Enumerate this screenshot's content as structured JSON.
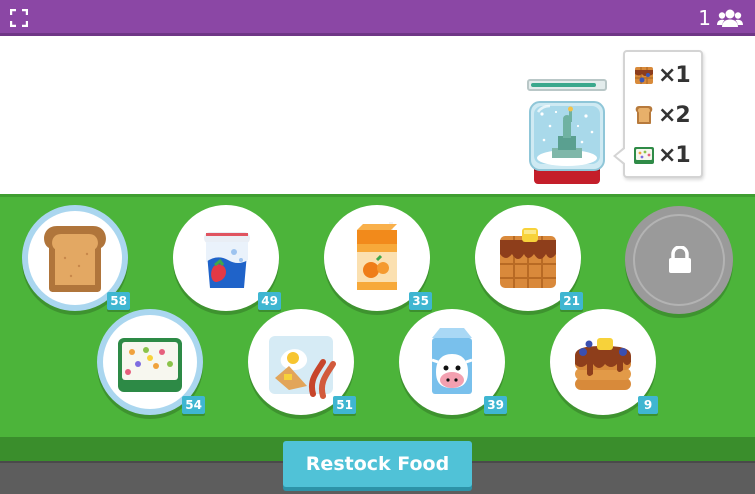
{
  "header": {
    "player_count": "1",
    "player_icon": "group-icon",
    "fullscreen_icon": "fullscreen-icon"
  },
  "customer": {
    "icon": "snow-globe-statue-of-liberty-icon",
    "patience_fraction": 0.9,
    "order": [
      {
        "item": "waffle-icon",
        "qty": "×1"
      },
      {
        "item": "toast-icon",
        "qty": "×2"
      },
      {
        "item": "cereal-icon",
        "qty": "×1"
      }
    ]
  },
  "foods": [
    {
      "name": "toast",
      "icon": "toast-icon",
      "count": "58"
    },
    {
      "name": "yogurt",
      "icon": "yogurt-icon",
      "count": "49"
    },
    {
      "name": "orange-juice",
      "icon": "orange-juice-icon",
      "count": "35"
    },
    {
      "name": "waffle",
      "icon": "waffle-icon",
      "count": "21"
    },
    {
      "name": "cereal",
      "icon": "cereal-icon",
      "count": "54"
    },
    {
      "name": "eggs-and-bacon",
      "icon": "eggs-bacon-icon",
      "count": "51"
    },
    {
      "name": "milk",
      "icon": "milk-icon",
      "count": "39"
    },
    {
      "name": "pancakes",
      "icon": "pancakes-icon",
      "count": "9"
    }
  ],
  "locked_slot": {
    "icon": "lock-icon"
  },
  "restock_label": "Restock Food",
  "colors": {
    "header": "#8b47a5",
    "counter": "#4cb43a",
    "badge": "#3fb6d1",
    "button": "#50c2d7"
  }
}
